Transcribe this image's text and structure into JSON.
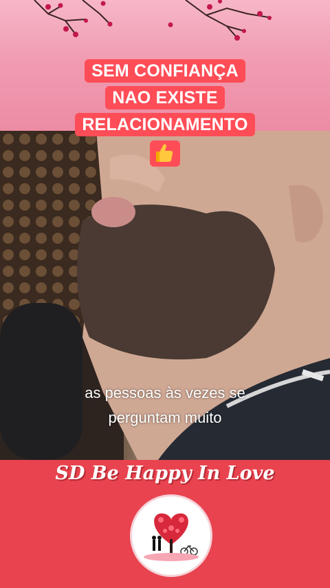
{
  "caption": {
    "line1": "SEM CONFIANÇA",
    "line2": "NAO EXISTE",
    "line3": "RELACIONAMENTO",
    "emoji": "👍"
  },
  "subtitle": {
    "line1": "as pessoas às vezes se",
    "line2": "perguntam muito"
  },
  "brand": {
    "name": "SD Be Happy In Love"
  },
  "colors": {
    "banner_pink": "#f19cb2",
    "caption_red": "#ff4d57",
    "bottom_red": "#e8434e"
  },
  "icons": {
    "thumbs_up": "thumbs-up-icon",
    "logo": "love-tree-logo"
  }
}
